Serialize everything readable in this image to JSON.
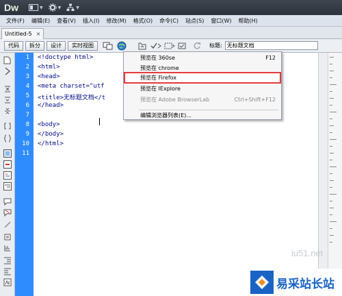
{
  "app": {
    "logo": "Dw"
  },
  "menus": [
    "文件(F)",
    "编辑(E)",
    "查看(V)",
    "插入(I)",
    "修改(M)",
    "格式(O)",
    "命令(C)",
    "站点(S)",
    "窗口(W)",
    "帮助(H)"
  ],
  "document": {
    "tab_name": "Untitled-5",
    "close_glyph": "×"
  },
  "view_buttons": [
    "代码",
    "拆分",
    "设计",
    "实时视图"
  ],
  "title_field": {
    "label": "标题:",
    "value": "无标题文档"
  },
  "code": {
    "line_numbers": [
      "1",
      "2",
      "3",
      "4",
      "5",
      "6",
      "7",
      "8",
      "9",
      "10",
      "11"
    ],
    "lines": [
      "<!doctype html>",
      "<html>",
      "<head>",
      "<meta charset=\"utf",
      "<title>无标题文档</t",
      "</head>",
      "",
      "<body>",
      "</body>",
      "</html>",
      ""
    ]
  },
  "preview_menu": {
    "items": [
      {
        "label": "预览在 360se",
        "shortcut": "F12",
        "enabled": true
      },
      {
        "label": "预览在 chrome",
        "shortcut": "",
        "enabled": true
      },
      {
        "label": "预览在 Firefox",
        "shortcut": "",
        "enabled": true,
        "highlighted": true
      },
      {
        "label": "预览在 IExplore",
        "shortcut": "",
        "enabled": true
      },
      {
        "label": "预览在 Adobe BrowserLab",
        "shortcut": "Ctrl+Shift+F12",
        "enabled": false
      },
      {
        "label": "编辑浏览器列表(E)...",
        "shortcut": "",
        "enabled": true
      }
    ],
    "highlight_color": "#e53a3a"
  },
  "watermark": {
    "url_text": "iu51.net",
    "name": "易采站长站"
  },
  "colors": {
    "gutter": "#2f8cff",
    "code_text": "#000a8a",
    "brand_blue": "#1a63c5"
  }
}
